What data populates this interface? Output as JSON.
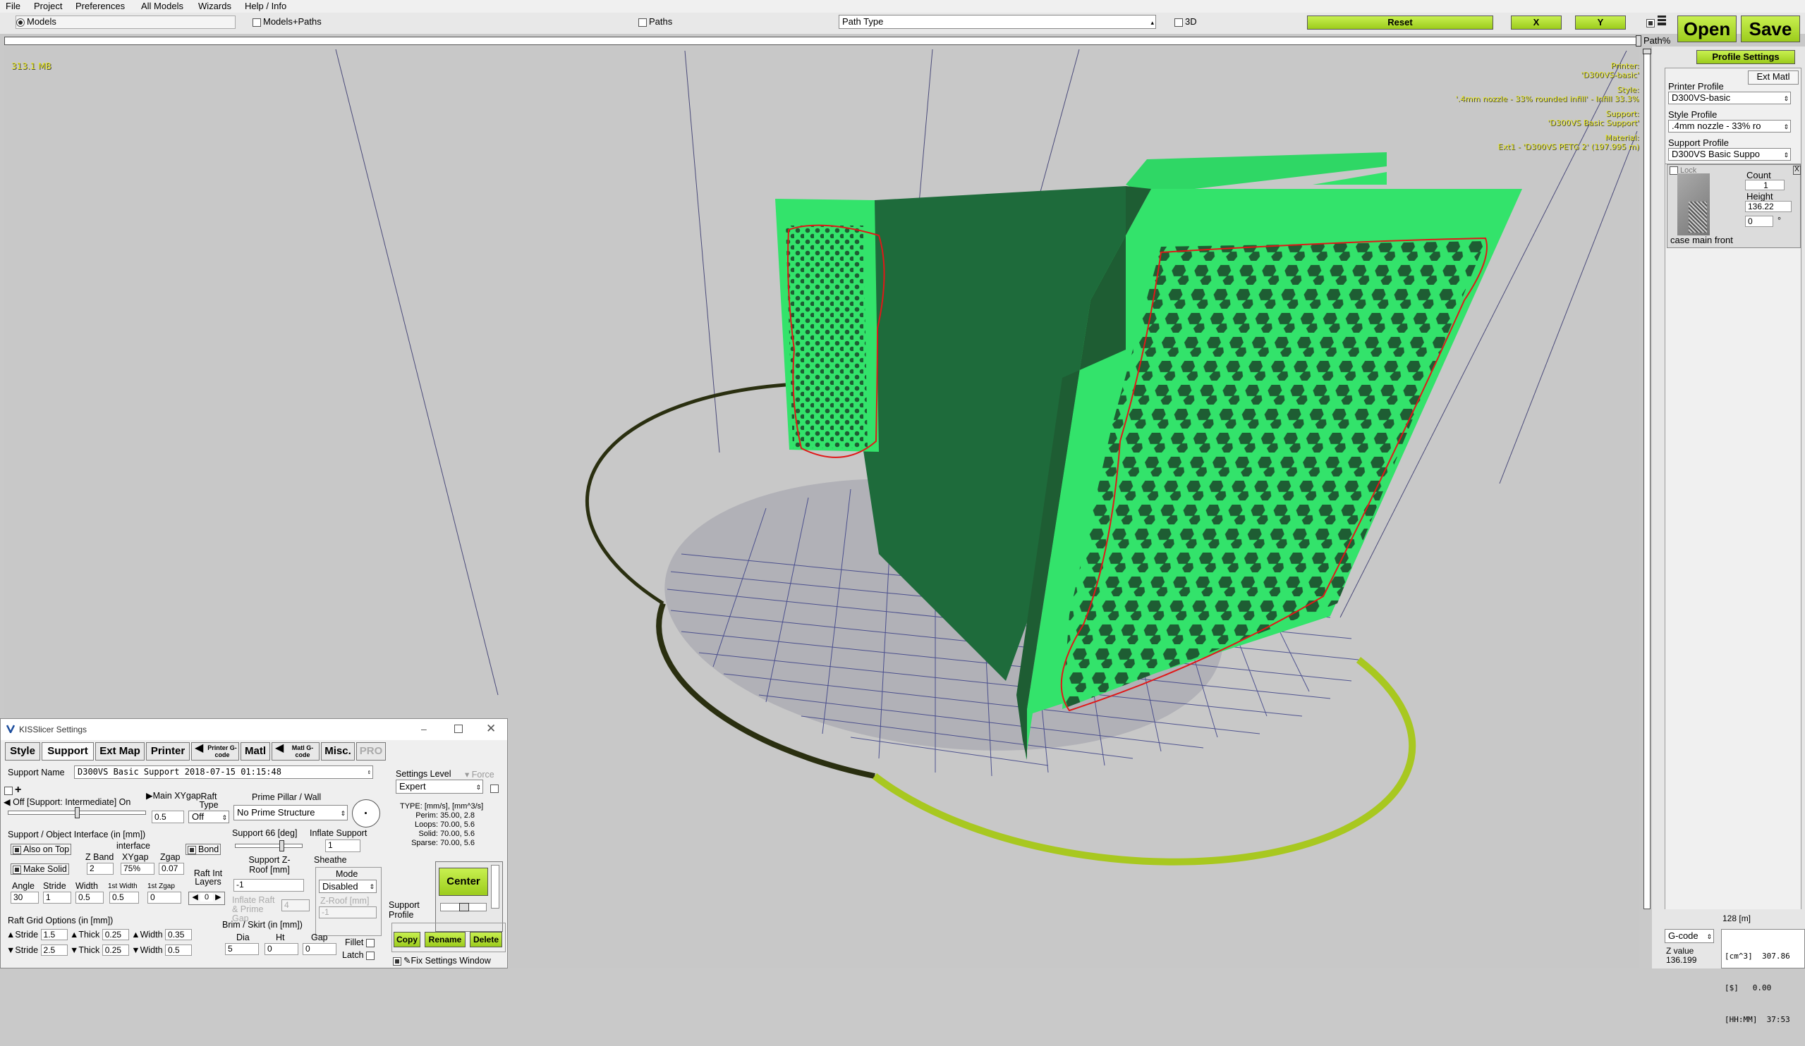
{
  "menu": [
    "File",
    "Project",
    "Preferences",
    "All Models",
    "Wizards",
    "Help / Info"
  ],
  "toolbar": {
    "models": "Models",
    "models_paths": "Models+Paths",
    "paths": "Paths",
    "path_type": "Path Type",
    "three_d": "3D",
    "reset": "Reset",
    "x": "X",
    "y": "Y",
    "open": "Open",
    "save": "Save",
    "path_pct": "Path%"
  },
  "viewport": {
    "memory": "313.1 MB",
    "hud": [
      "Printer:",
      "'D300VS-basic'",
      "Style:",
      "'.4mm nozzle - 33% rounded infill' - Infill 33.3%",
      "Support:",
      "'D300VS Basic Support'",
      "Material:",
      "Ext1 - 'D300VS PETG 2' (197.995 m)"
    ],
    "colors": {
      "model": "#33e36b",
      "model_dark": "#1e6b3b",
      "bed_rim": "#a8c820",
      "annotation": "#d81818"
    }
  },
  "right_panel": {
    "profile_settings": "Profile Settings",
    "ext_matl": "Ext Matl",
    "printer_profile_label": "Printer Profile",
    "printer_profile": "D300VS-basic",
    "style_profile_label": "Style Profile",
    "style_profile": ".4mm nozzle - 33% ro",
    "support_profile_label": "Support Profile",
    "support_profile": "D300VS Basic Suppo",
    "lock": "Lock",
    "count_label": "Count",
    "count": "1",
    "height_label": "Height",
    "height": "136.22",
    "rotate": "0",
    "degree": "°",
    "model_name": "case main front",
    "close": "X",
    "length": "128 [m]",
    "output_mode": "G-code",
    "z_value_label": "Z value",
    "z_value": "136.199",
    "stats": [
      "[cm^3]  307.86",
      "[$]   0.00",
      "[HH:MM]  37:53"
    ]
  },
  "settings": {
    "title": "KISSlicer Settings",
    "tabs": [
      "Style",
      "Support",
      "Ext Map",
      "Printer",
      "Printer G-code",
      "Matl",
      "Matl G-code",
      "Misc.",
      "PRO"
    ],
    "support_name_label": "Support Name",
    "support_name": "D300VS Basic Support  2018-07-15 01:15:48",
    "settings_level_label": "Settings Level",
    "settings_level": "Expert",
    "force_label": "Force",
    "off_on": "Off [Support: Intermediate] On",
    "main_xygap_label": "Main XYgap",
    "main_xygap": "0.5",
    "raft_type_label": "Raft Type",
    "raft_type": "Off",
    "prime_pillar_label": "Prime Pillar / Wall",
    "prime_structure": "No Prime Structure",
    "type_label": "TYPE: [mm/s], [mm^3/s]",
    "speeds": [
      {
        "name": "Perim:",
        "v": "35.00,  2.8"
      },
      {
        "name": "Loops:",
        "v": "70.00,  5.6"
      },
      {
        "name": "Solid:",
        "v": "70.00,  5.6"
      },
      {
        "name": "Sparse:",
        "v": "70.00,  5.6"
      }
    ],
    "interface_header": "Support / Object Interface (in [mm])",
    "also_on_top": "Also on Top",
    "interface_label": "interface",
    "bond": "Bond",
    "make_solid": "Make Solid",
    "z_band_label": "Z Band",
    "z_band": "2",
    "xygap_label": "XYgap",
    "xygap": "75%",
    "zgap_label": "Zgap",
    "zgap": "0.07",
    "angle_label": "Angle",
    "angle": "30",
    "stride_label": "Stride",
    "stride": "1",
    "width_label": "Width",
    "width": "0.5",
    "first_width_label": "1st Width",
    "first_width": "0.5",
    "first_zgap_label": "1st Zgap",
    "first_zgap": "0",
    "raft_int_label": "Raft Int Layers",
    "raft_int": "0",
    "support_deg_label": "Support 66 [deg]",
    "inflate_label": "Inflate Support",
    "inflate": "1",
    "support_zroof_label": "Support Z-Roof [mm]",
    "support_zroof": "-1",
    "sheathe_label": "Sheathe",
    "mode_label": "Mode",
    "mode": "Disabled",
    "zroof_mm_label": "Z-Roof [mm]",
    "zroof_mm": "-1",
    "inflate_raft_label": "Inflate Raft & Prime Gap",
    "inflate_raft": "4",
    "center": "Center",
    "raft_grid_header": "Raft Grid Options (in [mm])",
    "raft_rows": [
      {
        "stride_label": "Stride",
        "stride": "1.5",
        "thick_label": "Thick",
        "thick": "0.25",
        "width_label": "Width",
        "width": "0.35"
      },
      {
        "stride_label": "Stride",
        "stride": "2.5",
        "thick_label": "Thick",
        "thick": "0.25",
        "width_label": "Width",
        "width": "0.5"
      }
    ],
    "brim_header": "Brim / Skirt (in [mm])",
    "dia_label": "Dia",
    "dia": "5",
    "ht_label": "Ht",
    "ht": "0",
    "gap_label": "Gap",
    "gap": "0",
    "fillet": "Fillet",
    "latch": "Latch",
    "support_profile_label": "Support Profile",
    "copy": "Copy",
    "rename": "Rename",
    "delete": "Delete",
    "fix_window": "Fix Settings Window"
  }
}
